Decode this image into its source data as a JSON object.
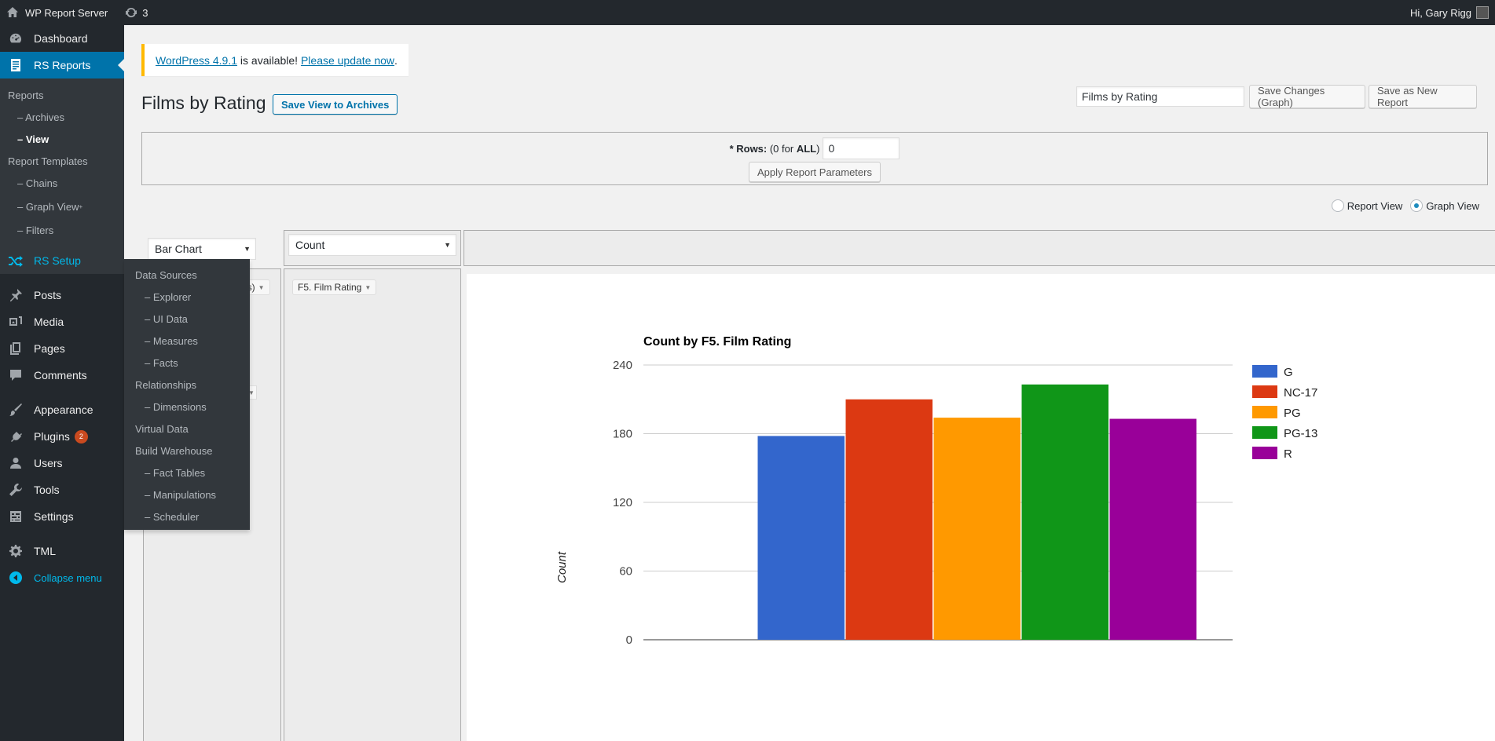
{
  "adminbar": {
    "site_name": "WP Report Server",
    "updates_count": "3",
    "greeting": "Hi, Gary Rigg"
  },
  "menu": {
    "dashboard": "Dashboard",
    "rs_reports": "RS Reports",
    "reports_sub": {
      "reports": "Reports",
      "archives": "– Archives",
      "view": "– View",
      "templates": "Report Templates",
      "chains": "– Chains",
      "graph_view": "– Graph View",
      "graph_view_sup": "+",
      "filters": "– Filters"
    },
    "rs_setup": "RS Setup",
    "posts": "Posts",
    "media": "Media",
    "pages": "Pages",
    "comments": "Comments",
    "appearance": "Appearance",
    "plugins": "Plugins",
    "plugins_badge": "2",
    "users": "Users",
    "tools": "Tools",
    "settings": "Settings",
    "tml": "TML",
    "collapse": "Collapse menu"
  },
  "flyout": {
    "data_sources": "Data Sources",
    "explorer": "– Explorer",
    "ui_data": "– UI Data",
    "measures": "– Measures",
    "facts": "– Facts",
    "relationships": "Relationships",
    "dimensions": "– Dimensions",
    "virtual_data": "Virtual Data",
    "build_warehouse": "Build Warehouse",
    "fact_tables": "– Fact Tables",
    "manipulations": "– Manipulations",
    "scheduler": "– Scheduler"
  },
  "notice": {
    "version_link": "WordPress 4.9.1",
    "middle": " is available! ",
    "update_link": "Please update now",
    "end": "."
  },
  "page": {
    "title": "Films by Rating",
    "save_archives": "Save View to Archives",
    "report_name_value": "Films by Rating",
    "save_changes": "Save Changes (Graph)",
    "save_new": "Save as New Report"
  },
  "params": {
    "rows_label": "* Rows:",
    "rows_hint_pre": " (0 for ",
    "rows_hint_all": "ALL",
    "rows_hint_post": ")",
    "rows_value": "0",
    "apply": "Apply Report Parameters"
  },
  "view_toggle": {
    "report_view": "Report View",
    "graph_view": "Graph View",
    "selected": "graph"
  },
  "graph_controls": {
    "chart_type": "Bar Chart",
    "measure": "Count",
    "left_pill_partial": "es)",
    "dimension_pill": "F5. Film Rating"
  },
  "chart_data": {
    "type": "bar",
    "title": "Count by F5. Film Rating",
    "ylabel": "Count",
    "xlabel": "",
    "ylim": [
      0,
      240
    ],
    "yticks": [
      "0",
      "60",
      "120",
      "180",
      "240"
    ],
    "grid": true,
    "legend_position": "right",
    "series": [
      {
        "name": "G",
        "value": 178,
        "color": "#3366cc"
      },
      {
        "name": "NC-17",
        "value": 210,
        "color": "#dc3912"
      },
      {
        "name": "PG",
        "value": 194,
        "color": "#ff9900"
      },
      {
        "name": "PG-13",
        "value": 223,
        "color": "#109618"
      },
      {
        "name": "R",
        "value": 193,
        "color": "#990099"
      }
    ]
  }
}
